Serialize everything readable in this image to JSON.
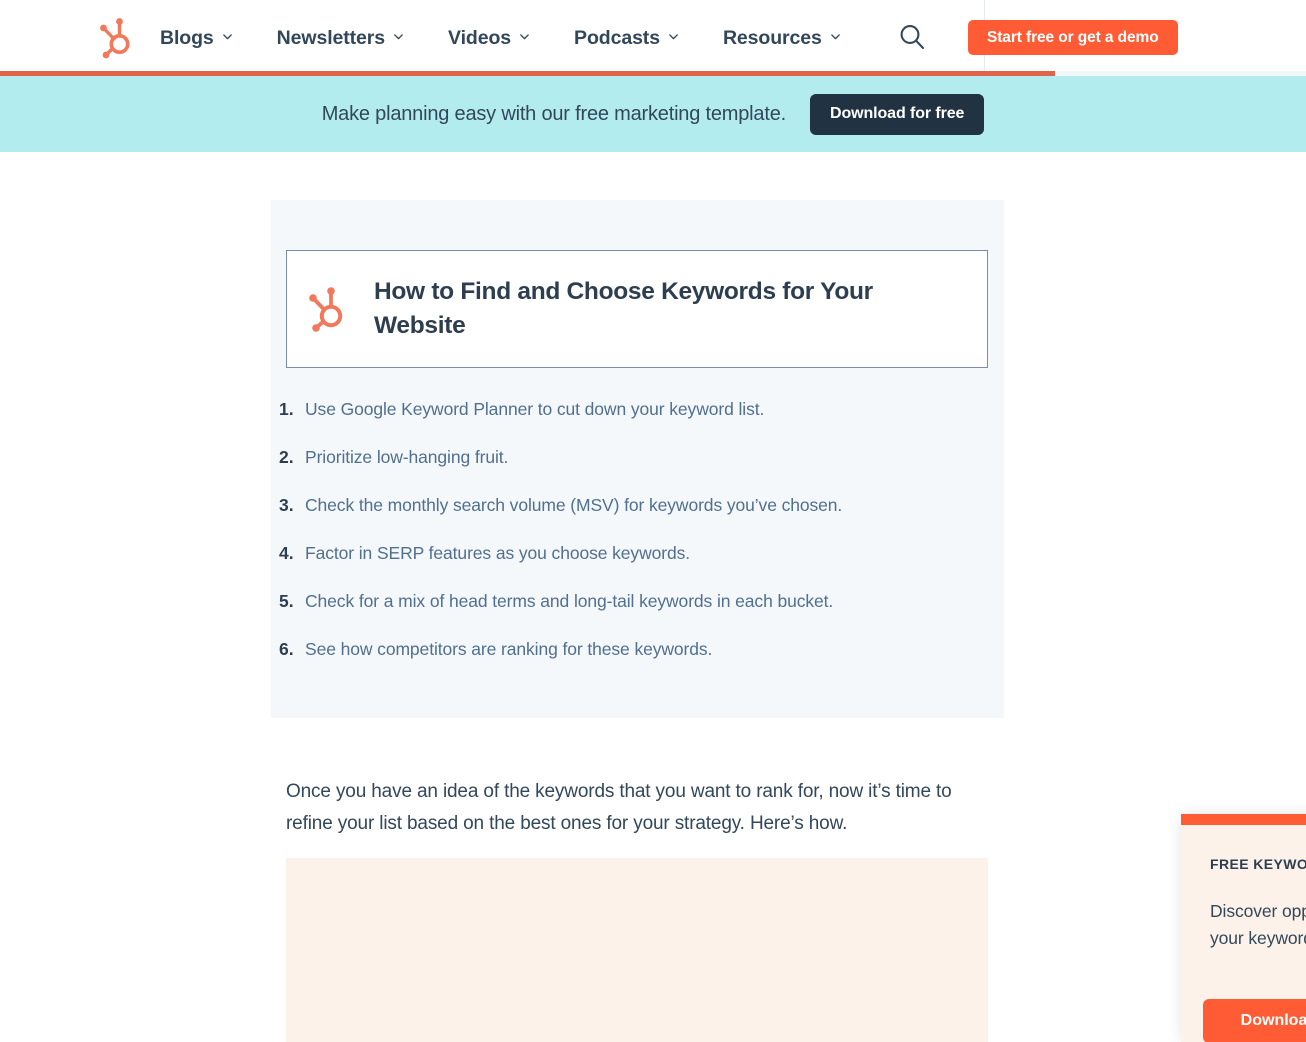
{
  "nav": {
    "logo_icon": "hubspot-sprocket-logo",
    "items": [
      {
        "label": "Blogs",
        "icon": "chevron-down-icon"
      },
      {
        "label": "Newsletters",
        "icon": "chevron-down-icon"
      },
      {
        "label": "Videos",
        "icon": "chevron-down-icon"
      },
      {
        "label": "Podcasts",
        "icon": "chevron-down-icon"
      },
      {
        "label": "Resources",
        "icon": "chevron-down-icon"
      }
    ],
    "search_icon": "search-icon",
    "cta_label": "Start free or get a demo",
    "accent_color": "#ff5c35",
    "progress_color": "#e0644a",
    "progress_percent": 81
  },
  "promo": {
    "text": "Make planning easy with our free marketing template.",
    "button_label": "Download for free",
    "background_color": "#b3ecef",
    "button_color": "#213343"
  },
  "callout": {
    "logo_icon": "hubspot-sprocket-logo",
    "title": "How to Find and Choose Keywords for Your Website",
    "card_background": "#f4f8fa",
    "inner_border_color": "#7c8ca6",
    "steps": [
      {
        "num": "1.",
        "text": "Use Google Keyword Planner to cut down your keyword list."
      },
      {
        "num": "2.",
        "text": "Prioritize low-hanging fruit."
      },
      {
        "num": "3.",
        "text": "Check the monthly search volume (MSV) for keywords you’ve chosen."
      },
      {
        "num": "4.",
        "text": "Factor in SERP features as you choose keywords."
      },
      {
        "num": "5.",
        "text": "Check for a mix of head terms and long-tail keywords in each bucket."
      },
      {
        "num": "6.",
        "text": "See how competitors are ranking for these keywords."
      }
    ]
  },
  "article": {
    "paragraph": "Once you have an idea of the keywords that you want to rank for, now it’s time to refine your list based on the best ones for your strategy. Here’s how.",
    "cream_box_color": "#fdf2ea"
  },
  "popup": {
    "eyebrow": "FREE KEYWORD TOOL",
    "description": "Discover opportunities for your keyword strategy.",
    "button_label": "Download Now",
    "bar_color": "#ff5c35",
    "background_color": "#fdf2e9"
  }
}
